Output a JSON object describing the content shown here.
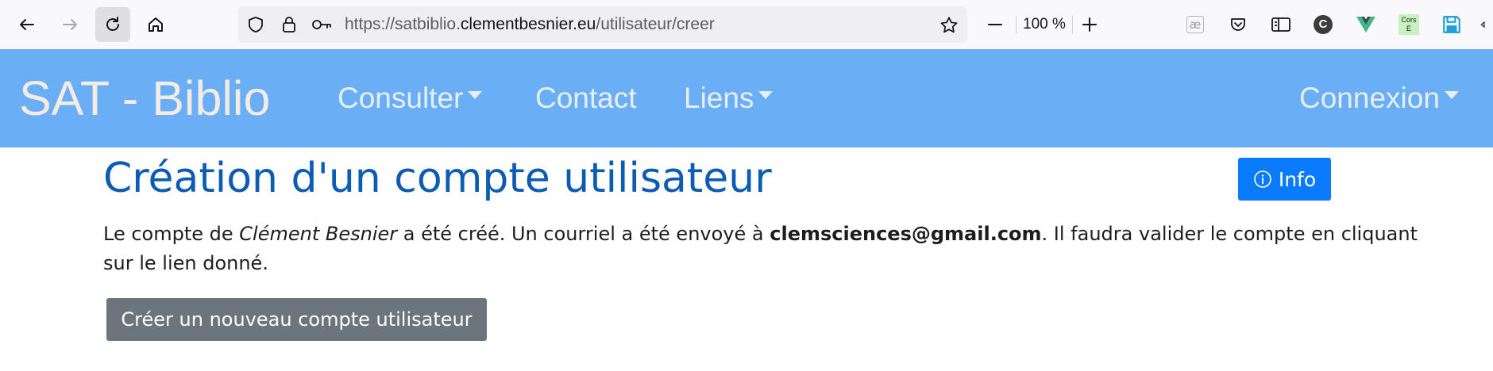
{
  "browser": {
    "url_prefix": "https://satbiblio.",
    "url_domain": "clementbesnier.eu",
    "url_path": "/utilisateur/creer",
    "zoom_level": "100 %",
    "icons": [
      "back-arrow-icon",
      "forward-arrow-icon",
      "reload-icon",
      "home-icon",
      "shield-icon",
      "lock-icon",
      "key-icon",
      "star-icon",
      "zoom-out-icon",
      "zoom-in-icon"
    ],
    "extensions": {
      "ext_ae_label": "æ",
      "ext_c_label": "C",
      "ext_cors_line1": "Cors",
      "ext_cors_line2": "E"
    }
  },
  "navbar": {
    "brand": "SAT - Biblio",
    "items": [
      {
        "label": "Consulter",
        "dropdown": true
      },
      {
        "label": "Contact",
        "dropdown": false
      },
      {
        "label": "Liens",
        "dropdown": true
      }
    ],
    "right_item": {
      "label": "Connexion",
      "dropdown": true
    },
    "bg_color": "#6aaef5"
  },
  "main": {
    "title": "Création d'un compte utilisateur",
    "info_button": "Info",
    "message": {
      "part1": "Le compte de ",
      "user_name": "Clément Besnier",
      "part2": " a été créé. Un courriel a été envoyé à ",
      "email": "clemsciences@gmail.com",
      "part3": ". Il faudra valider le compte en cliquant sur le lien donné."
    },
    "create_button": "Créer un nouveau compte utilisateur",
    "accent_color": "#0a7bfc",
    "title_color": "#0c5cb3"
  }
}
